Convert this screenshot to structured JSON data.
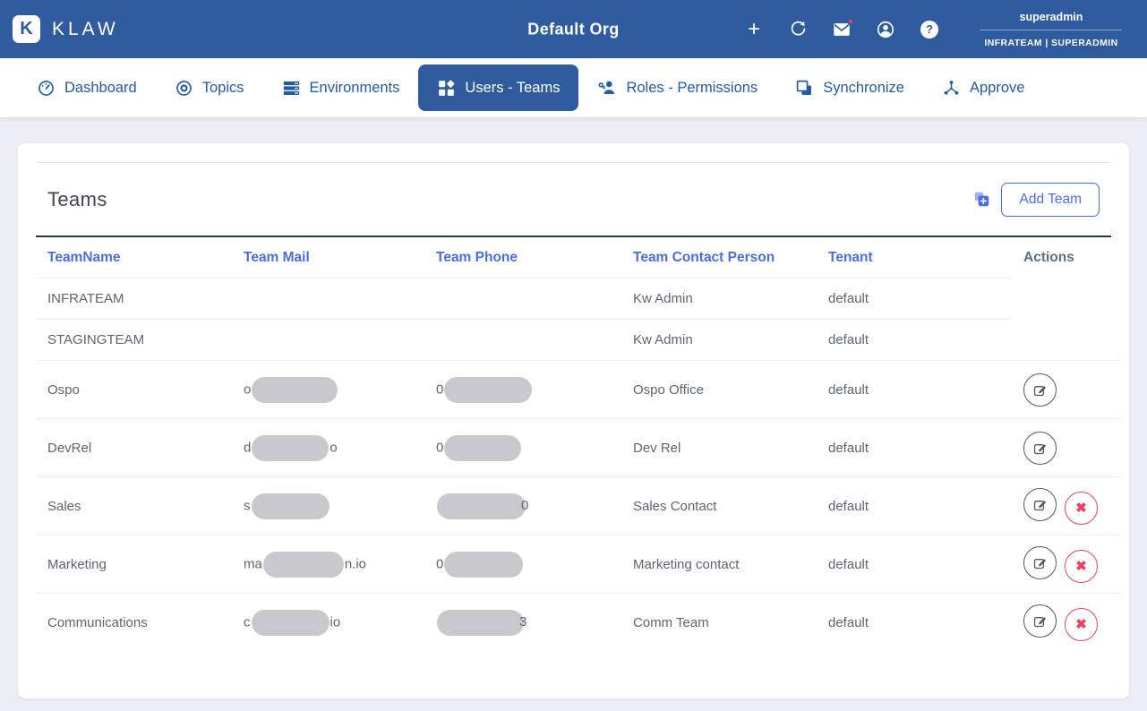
{
  "header": {
    "logo_letter": "K",
    "logo_text": "KLAW",
    "org_title": "Default Org",
    "username": "superadmin",
    "user_team_role": "INFRATEAM | SUPERADMIN",
    "icons": [
      "add-icon",
      "refresh-icon",
      "mail-unread-icon",
      "account-icon",
      "help-icon"
    ],
    "help_glyph": "?",
    "plus_glyph": "+"
  },
  "nav": {
    "tabs": [
      {
        "label": "Dashboard",
        "icon": "gauge-icon",
        "active": false
      },
      {
        "label": "Topics",
        "icon": "target-icon",
        "active": false
      },
      {
        "label": "Environments",
        "icon": "servers-icon",
        "active": false
      },
      {
        "label": "Users - Teams",
        "icon": "tiles-icon",
        "active": true
      },
      {
        "label": "Roles - Permissions",
        "icon": "person-key-icon",
        "active": false
      },
      {
        "label": "Synchronize",
        "icon": "overlap-squares-icon",
        "active": false
      },
      {
        "label": "Approve",
        "icon": "hub-icon",
        "active": false
      }
    ]
  },
  "teams": {
    "title": "Teams",
    "add_button_label": "Add Team",
    "columns": [
      "TeamName",
      "Team Mail",
      "Team Phone",
      "Team Contact Person",
      "Tenant",
      "Actions"
    ],
    "rows": [
      {
        "team_name": "INFRATEAM",
        "mail_prefix": "",
        "mail_suffix": "",
        "phone_prefix": "",
        "phone_suffix": "",
        "contact": "Kw Admin",
        "tenant": "default",
        "mail_redacted": false,
        "phone_redacted": false,
        "can_edit": false,
        "can_delete": false
      },
      {
        "team_name": "STAGINGTEAM",
        "mail_prefix": "",
        "mail_suffix": "",
        "phone_prefix": "",
        "phone_suffix": "",
        "contact": "Kw Admin",
        "tenant": "default",
        "mail_redacted": false,
        "phone_redacted": false,
        "can_edit": false,
        "can_delete": false
      },
      {
        "team_name": "Ospo",
        "mail_prefix": "o",
        "mail_suffix": "",
        "phone_prefix": "0",
        "phone_suffix": "",
        "contact": "Ospo Office",
        "tenant": "default",
        "mail_redacted": true,
        "phone_redacted": true,
        "can_edit": true,
        "can_delete": false
      },
      {
        "team_name": "DevRel",
        "mail_prefix": "d",
        "mail_suffix": "o",
        "phone_prefix": "0",
        "phone_suffix": "",
        "contact": "Dev Rel",
        "tenant": "default",
        "mail_redacted": true,
        "phone_redacted": true,
        "can_edit": true,
        "can_delete": false
      },
      {
        "team_name": "Sales",
        "mail_prefix": "s",
        "mail_suffix": "",
        "phone_prefix": "",
        "phone_suffix": "0",
        "contact": "Sales Contact",
        "tenant": "default",
        "mail_redacted": true,
        "phone_redacted": true,
        "can_edit": true,
        "can_delete": true
      },
      {
        "team_name": "Marketing",
        "mail_prefix": "ma",
        "mail_suffix": "n.io",
        "phone_prefix": "0",
        "phone_suffix": "",
        "contact": "Marketing contact",
        "tenant": "default",
        "mail_redacted": true,
        "phone_redacted": true,
        "can_edit": true,
        "can_delete": true
      },
      {
        "team_name": "Communications",
        "mail_prefix": "c",
        "mail_suffix": "io",
        "phone_prefix": "",
        "phone_suffix": "3",
        "contact": "Comm Team",
        "tenant": "default",
        "mail_redacted": true,
        "phone_redacted": true,
        "can_edit": true,
        "can_delete": true
      }
    ],
    "delete_glyph": "✖"
  },
  "colors": {
    "header_bg": "#2f5c9e",
    "nav_blue": "#235c9f",
    "accent_blue": "#4b6de2",
    "actions_header": "#5d6e87",
    "danger_red": "#e8435f",
    "redaction_gray": "#c8c9cc",
    "body_text": "#5d6570",
    "heading_text": "#3e4653",
    "page_bg": "#eaeef4"
  }
}
